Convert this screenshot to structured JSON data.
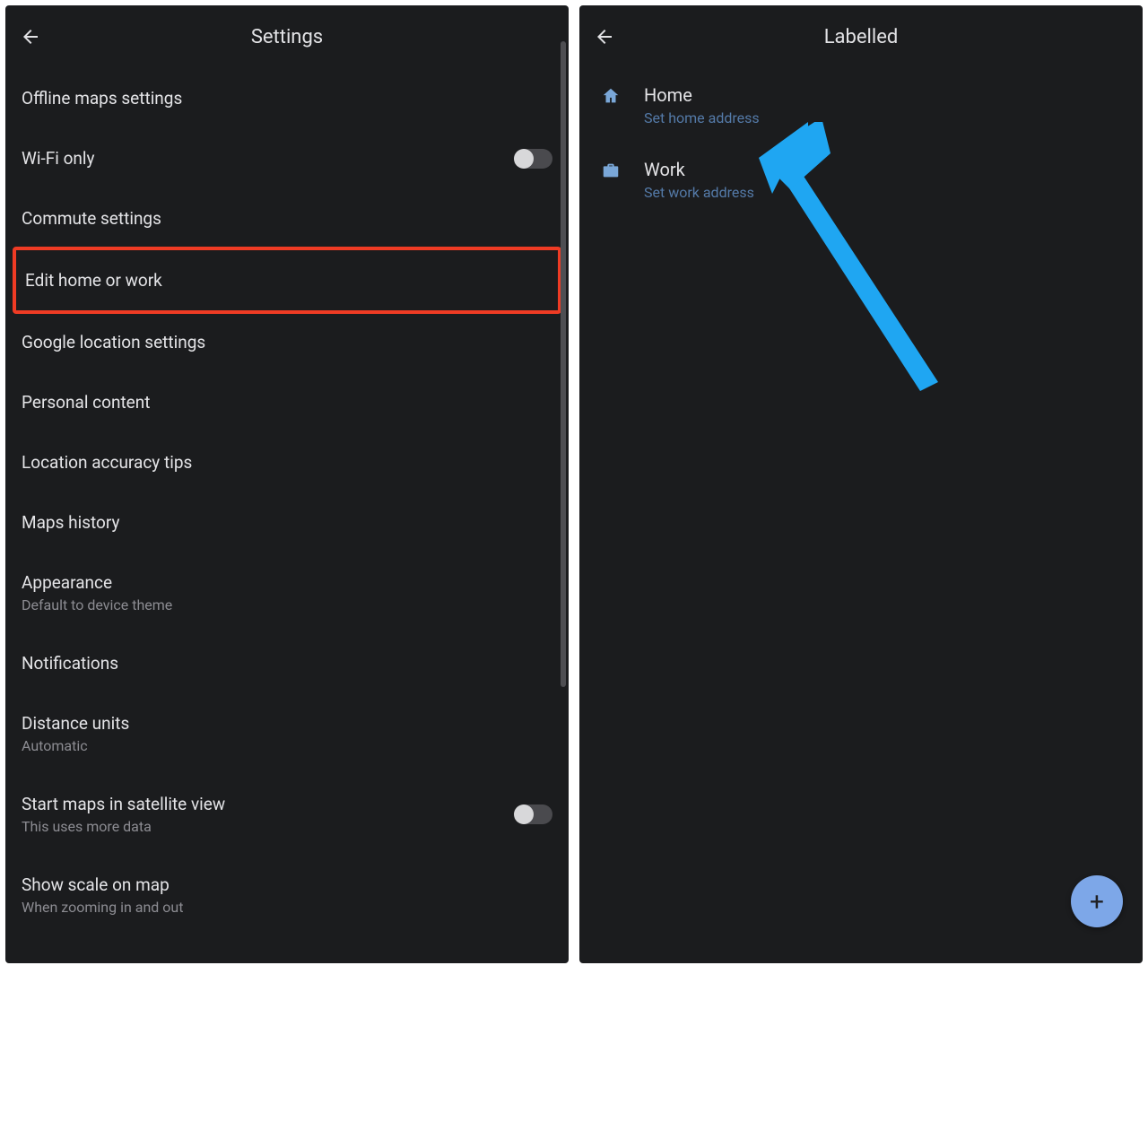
{
  "annotations": {
    "highlight_color": "#ef3b24",
    "arrow_color": "#1fa6f2"
  },
  "left": {
    "title": "Settings",
    "items": [
      {
        "title": "Offline maps settings"
      },
      {
        "title": "Wi-Fi only",
        "toggle": "off"
      },
      {
        "title": "Commute settings"
      },
      {
        "title": "Edit home or work",
        "highlighted": true
      },
      {
        "title": "Google location settings"
      },
      {
        "title": "Personal content"
      },
      {
        "title": "Location accuracy tips"
      },
      {
        "title": "Maps history"
      },
      {
        "title": "Appearance",
        "sub": "Default to device theme"
      },
      {
        "title": "Notifications"
      },
      {
        "title": "Distance units",
        "sub": "Automatic"
      },
      {
        "title": "Start maps in satellite view",
        "sub": "This uses more data",
        "toggle": "off"
      },
      {
        "title": "Show scale on map",
        "sub": "When zooming in and out"
      }
    ]
  },
  "right": {
    "title": "Labelled",
    "items": [
      {
        "icon": "home",
        "title": "Home",
        "sub": "Set home address"
      },
      {
        "icon": "work",
        "title": "Work",
        "sub": "Set work address"
      }
    ],
    "fab_label": "+"
  }
}
